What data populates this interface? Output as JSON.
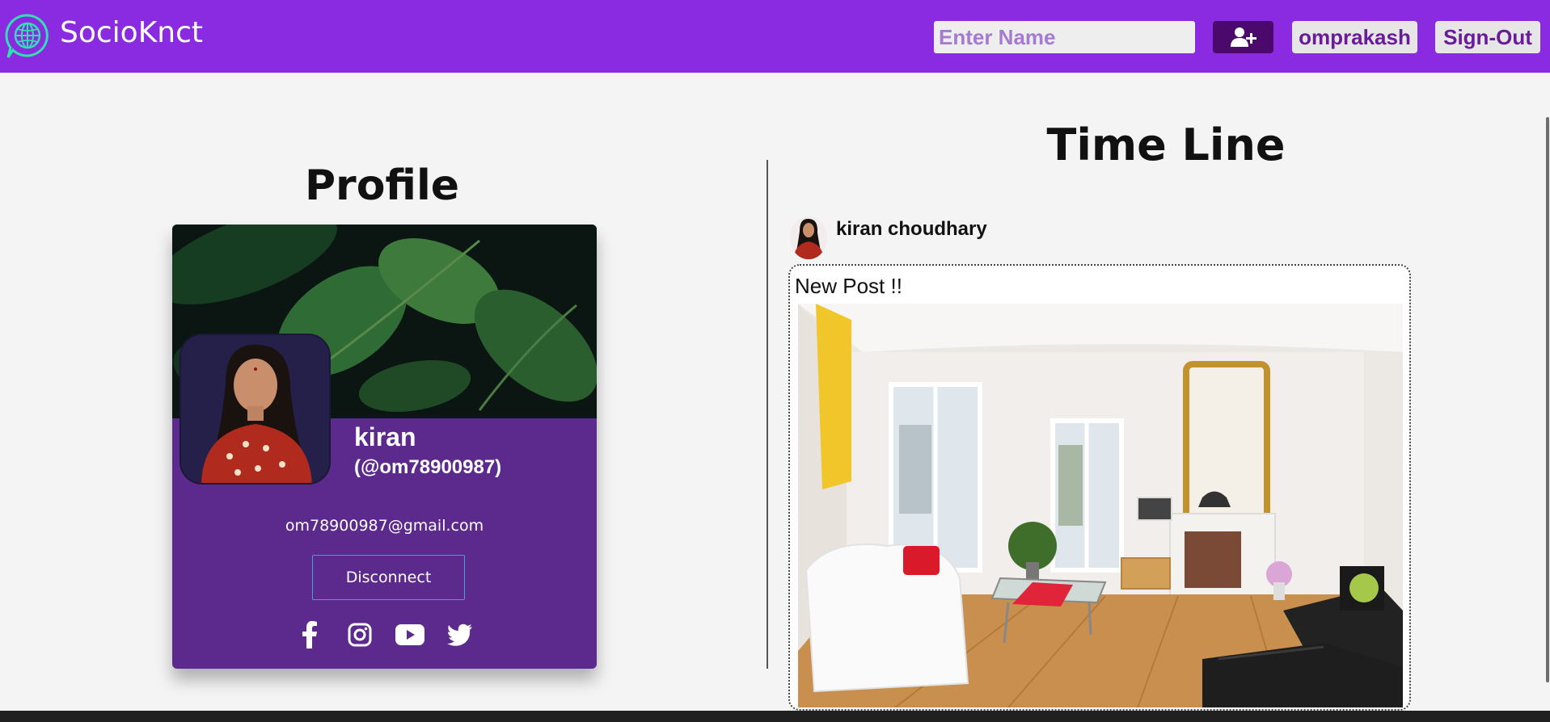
{
  "navbar": {
    "brand": "SocioKnct",
    "search_placeholder": "Enter Name",
    "current_user": "omprakash",
    "signout_label": "Sign-Out",
    "colors": {
      "background": "#8a2be2",
      "add_button": "#4b0a6b",
      "pill": "#e6e6e6"
    }
  },
  "profile": {
    "title": "Profile",
    "name": "kiran",
    "handle": "(@om78900987)",
    "email": "om78900987@gmail.com",
    "disconnect_label": "Disconnect",
    "socials": [
      "facebook-icon",
      "instagram-icon",
      "youtube-icon",
      "twitter-icon"
    ],
    "card_color": "#5b2a8c"
  },
  "timeline": {
    "title": "Time Line",
    "posts": [
      {
        "author": "kiran choudhary",
        "text": "New Post !!"
      }
    ]
  }
}
